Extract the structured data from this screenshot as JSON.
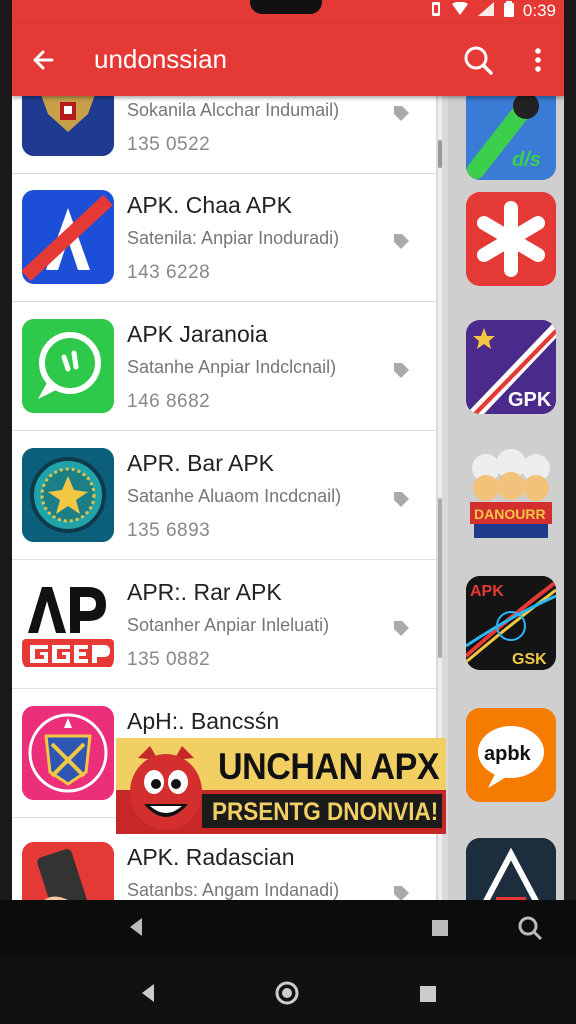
{
  "status_bar": {
    "time": "0:39"
  },
  "app_bar": {
    "title": "undonssian"
  },
  "apps": [
    {
      "title": "",
      "subtitle": "Sokanila Alcchar Indumail)",
      "count": "135 0522",
      "icon": "emblem-garuda-icon"
    },
    {
      "title": "APK. Chaa APK",
      "subtitle": "Satenila: Anpiar Inoduradi)",
      "count": "143 6228",
      "icon": "letter-a-slash-icon"
    },
    {
      "title": "APK Jaranoia",
      "subtitle": "Satanhe Anpiar Indclcnail)",
      "count": "146 8682",
      "icon": "chat-bubble-icon"
    },
    {
      "title": "APR. Bar APK",
      "subtitle": "Satanhe Aluaom Incdcnail)",
      "count": "135 6893",
      "icon": "seal-badge-icon"
    },
    {
      "title": "APR:. Rar APK",
      "subtitle": "Sotanher Anpiar Inleluati)",
      "count": "135 0882",
      "icon": "ap-ggep-logo-icon"
    },
    {
      "title": "ApH:. Bancsśn",
      "subtitle": "",
      "count": "",
      "icon": "crest-emblem-icon"
    },
    {
      "title": "APK. Radascian",
      "subtitle": "Satanbs: Angam Indanadi)",
      "count": "",
      "icon": "phone-hand-icon"
    }
  ],
  "side_icons": [
    {
      "label": "d/s",
      "icon": "green-pipe-icon"
    },
    {
      "label": "",
      "icon": "asterisk-icon"
    },
    {
      "label": "GPK",
      "icon": "flag-star-icon"
    },
    {
      "label": "DANOURR",
      "icon": "chefs-icon"
    },
    {
      "label": "APK",
      "label2": "GSK",
      "icon": "light-streak-icon"
    },
    {
      "label": "apbk",
      "icon": "speech-bubble-icon"
    },
    {
      "label": "",
      "icon": "triangle-icon"
    }
  ],
  "banner": {
    "title": "UNCHAN APX",
    "subtitle": "PRSENTG DNONVIA!"
  },
  "colors": {
    "primary": "#e53935",
    "banner_yellow": "#f2cf63",
    "banner_red": "#c62828"
  }
}
